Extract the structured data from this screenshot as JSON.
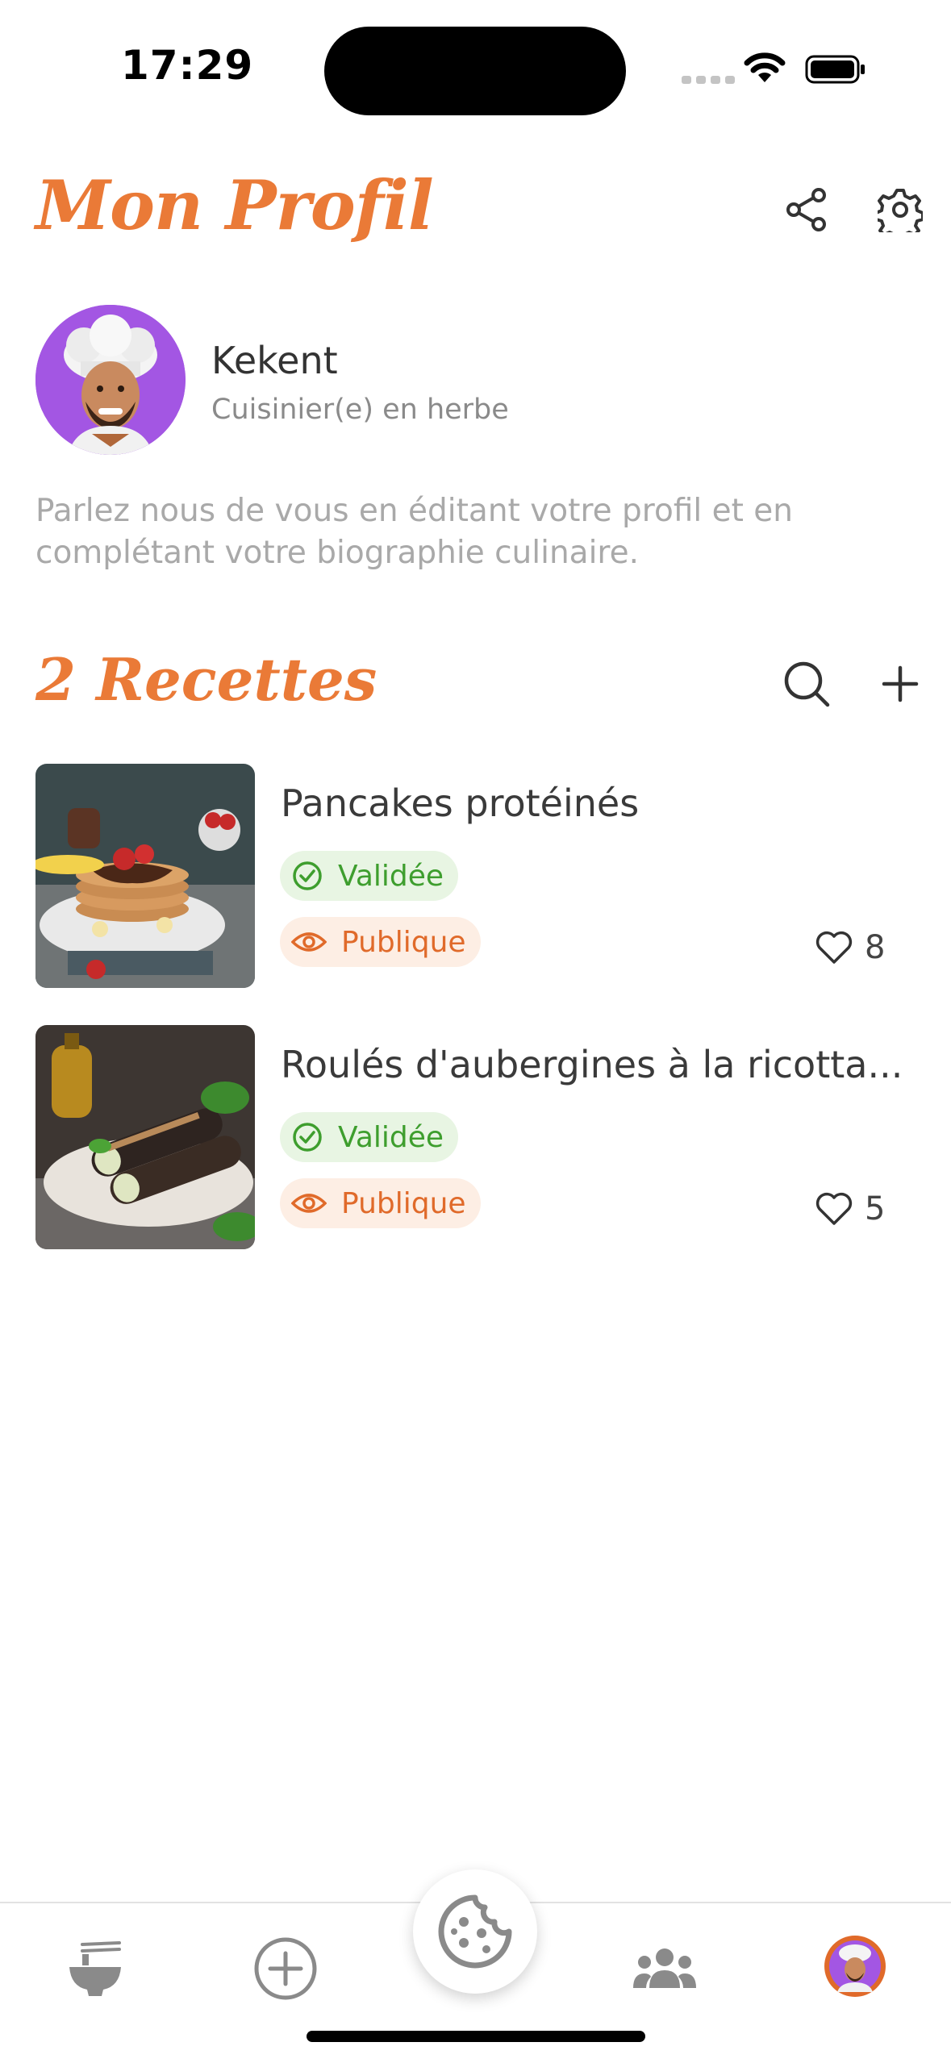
{
  "status_bar": {
    "time": "17:29"
  },
  "header": {
    "title": "Mon Profil",
    "share_icon": "share-icon",
    "settings_icon": "gear-icon"
  },
  "profile": {
    "name": "Kekent",
    "role": "Cuisinier(e) en herbe",
    "bio": "Parlez nous de vous en éditant votre profil et en complétant votre biographie culinaire."
  },
  "recipes_section": {
    "title": "2 Recettes",
    "search_icon": "search-icon",
    "add_icon": "plus-icon"
  },
  "recipes": [
    {
      "title": "Pancakes protéinés",
      "status": "Validée",
      "visibility": "Publique",
      "likes": "8"
    },
    {
      "title": "Roulés d'aubergines à la ricotta...",
      "status": "Validée",
      "visibility": "Publique",
      "likes": "5"
    }
  ],
  "tab_bar": {
    "items": [
      "bowl-icon",
      "add-circle-icon",
      "cookie-icon",
      "community-icon",
      "profile-avatar"
    ]
  },
  "colors": {
    "accent": "#ea7a37",
    "validated": "#3e9e2e",
    "public": "#e06a2a"
  }
}
